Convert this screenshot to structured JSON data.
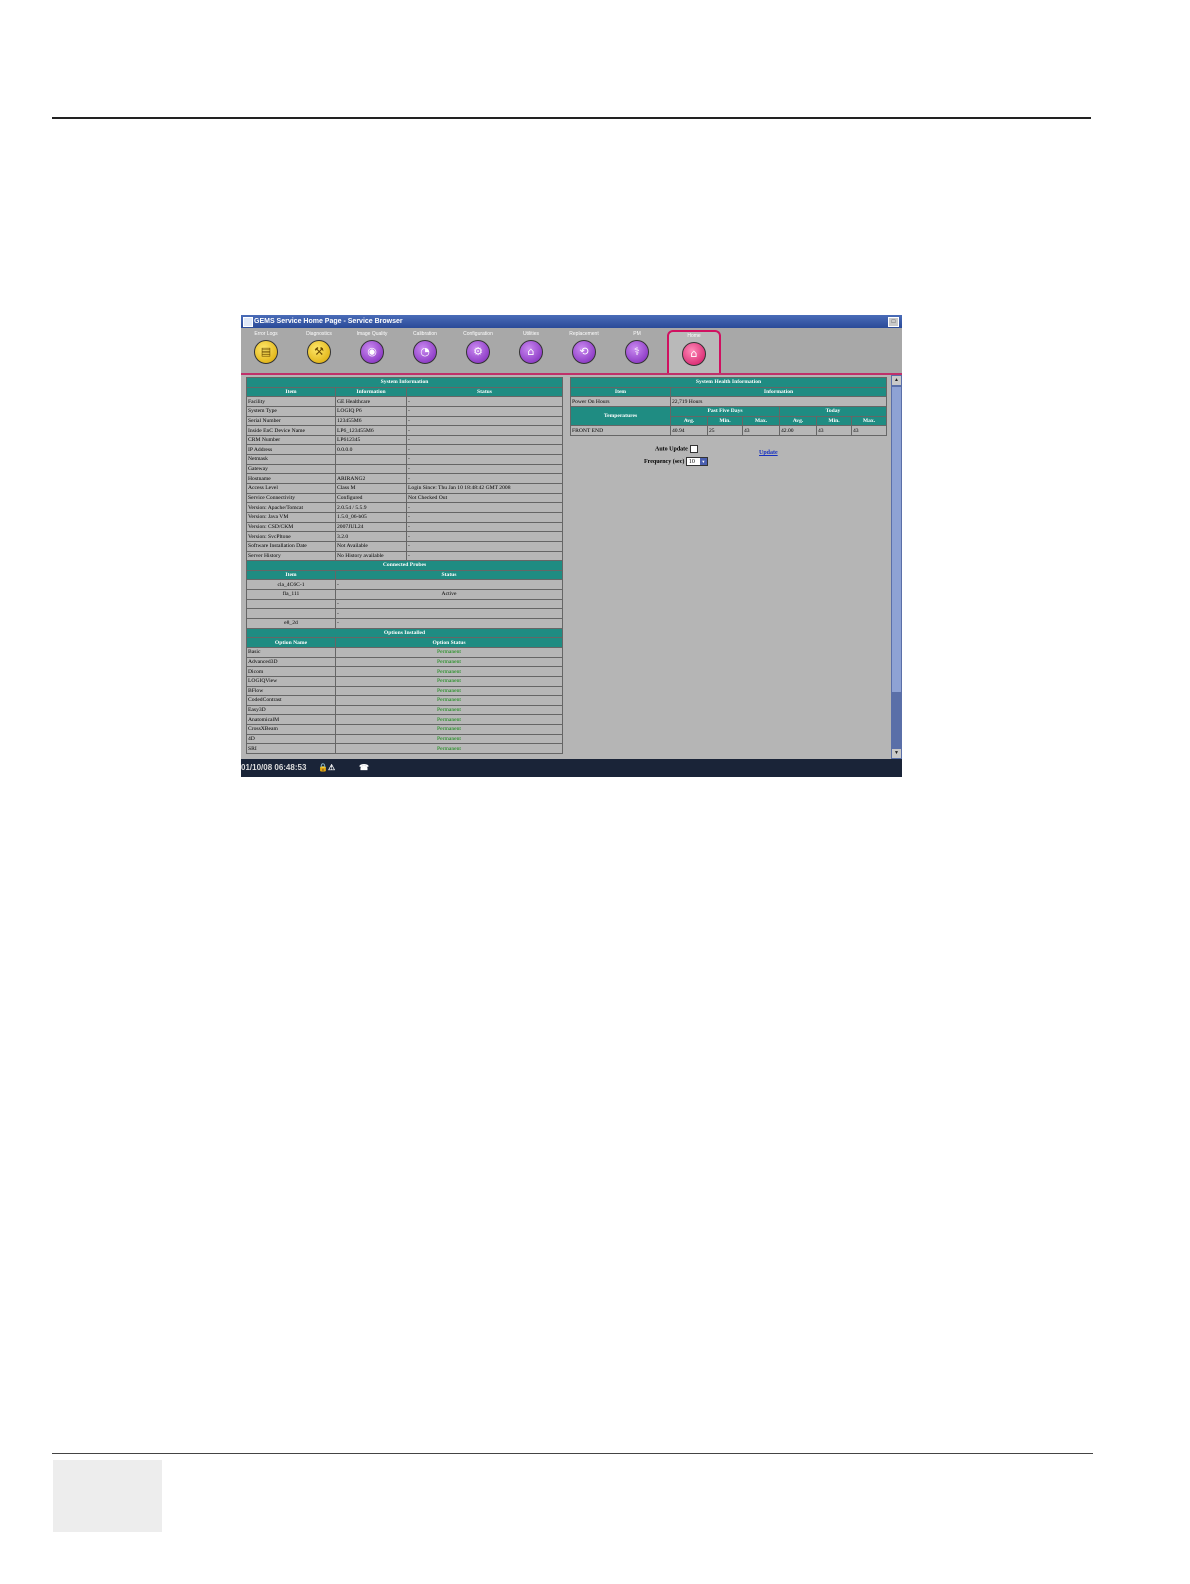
{
  "window": {
    "title": "GEMS Service Home Page - Service Browser"
  },
  "toolbar": {
    "tools": [
      {
        "label": "Error Logs",
        "icon": "error-logs-icon",
        "color": "yellow"
      },
      {
        "label": "Diagnostics",
        "icon": "diagnostics-icon",
        "color": "yellow"
      },
      {
        "label": "Image Quality",
        "icon": "image-quality-icon",
        "color": "purple"
      },
      {
        "label": "Calibration",
        "icon": "calibration-icon",
        "color": "purple"
      },
      {
        "label": "Configuration",
        "icon": "configuration-icon",
        "color": "purple"
      },
      {
        "label": "Utilities",
        "icon": "utilities-icon",
        "color": "purple"
      },
      {
        "label": "Replacement",
        "icon": "replacement-icon",
        "color": "purple"
      },
      {
        "label": "PM",
        "icon": "pm-icon",
        "color": "purple"
      },
      {
        "label": "Home",
        "icon": "home-icon",
        "color": "pink",
        "active": true
      }
    ]
  },
  "system_info": {
    "title": "System Information",
    "headers": [
      "Item",
      "Information",
      "Status"
    ],
    "rows": [
      [
        "Facility",
        "GE Healthcare",
        "-"
      ],
      [
        "System Type",
        "LOGIQ P6",
        "-"
      ],
      [
        "Serial Number",
        "123455M6",
        "-"
      ],
      [
        "Inside EnC Device Name",
        "LP6_123455M6",
        "-"
      ],
      [
        "CRM Number",
        "LP612345",
        "-"
      ],
      [
        "IP Address",
        "0.0.0.0",
        "-"
      ],
      [
        "Netmask",
        "",
        "-"
      ],
      [
        "Gateway",
        "",
        "-"
      ],
      [
        "Hostname",
        "ARIRANG2",
        "-"
      ],
      [
        "Access Level",
        "Class M",
        "Login Since: Thu Jan 10 18:48:42 GMT 2008"
      ],
      [
        "Service Connectivity",
        "Configured",
        "Not Checked Out"
      ],
      [
        "Version: Apache/Tomcat",
        "2.0.54 / 5.5.9",
        "-"
      ],
      [
        "Version: Java VM",
        "1.5.0_06-b05",
        "-"
      ],
      [
        "Version: CSD/CKM",
        "2007JUL24",
        "-"
      ],
      [
        "Version: SvcPltone",
        "3.2.0",
        "-"
      ],
      [
        "Software Installation Date",
        "Not Available",
        "-"
      ],
      [
        "Server History",
        "No History available",
        "-"
      ]
    ]
  },
  "probes": {
    "title": "Connected Probes",
    "headers": [
      "Item",
      "Status"
    ],
    "rows": [
      [
        "cla_4C6C-1",
        "-"
      ],
      [
        "fla_111",
        "Active"
      ],
      [
        "",
        "-"
      ],
      [
        "",
        "-"
      ],
      [
        "e8_2d",
        "-"
      ]
    ]
  },
  "options": {
    "title": "Options Installed",
    "headers": [
      "Option Name",
      "Option Status"
    ],
    "rows": [
      [
        "Basic",
        "Permanent"
      ],
      [
        "Advanced3D",
        "Permanent"
      ],
      [
        "Dicom",
        "Permanent"
      ],
      [
        "LOGIQView",
        "Permanent"
      ],
      [
        "BFlow",
        "Permanent"
      ],
      [
        "CodedContrast",
        "Permanent"
      ],
      [
        "Easy3D",
        "Permanent"
      ],
      [
        "AnatomicalM",
        "Permanent"
      ],
      [
        "CrossXBeam",
        "Permanent"
      ],
      [
        "4D",
        "Permanent"
      ],
      [
        "SRI",
        "Permanent"
      ]
    ]
  },
  "health": {
    "title": "System Health Information",
    "headers": [
      "Item",
      "Information"
    ],
    "power_on": [
      "Power On Hours",
      "22,719 Hours"
    ],
    "temp_label": "Temperatures",
    "past_label": "Past Five Days",
    "today_label": "Today",
    "sub": [
      "Avg.",
      "Min.",
      "Max.",
      "Avg.",
      "Min.",
      "Max."
    ],
    "front_end": [
      "FRONT END",
      "40.94",
      "25",
      "43",
      "42.00",
      "43",
      "43"
    ],
    "auto_update_label": "Auto Update",
    "frequency_label": "Frequency (sec)",
    "frequency_value": "10",
    "update_link": "Update"
  },
  "taskbar": {
    "datetime": "01/10/08 06:48:53"
  }
}
